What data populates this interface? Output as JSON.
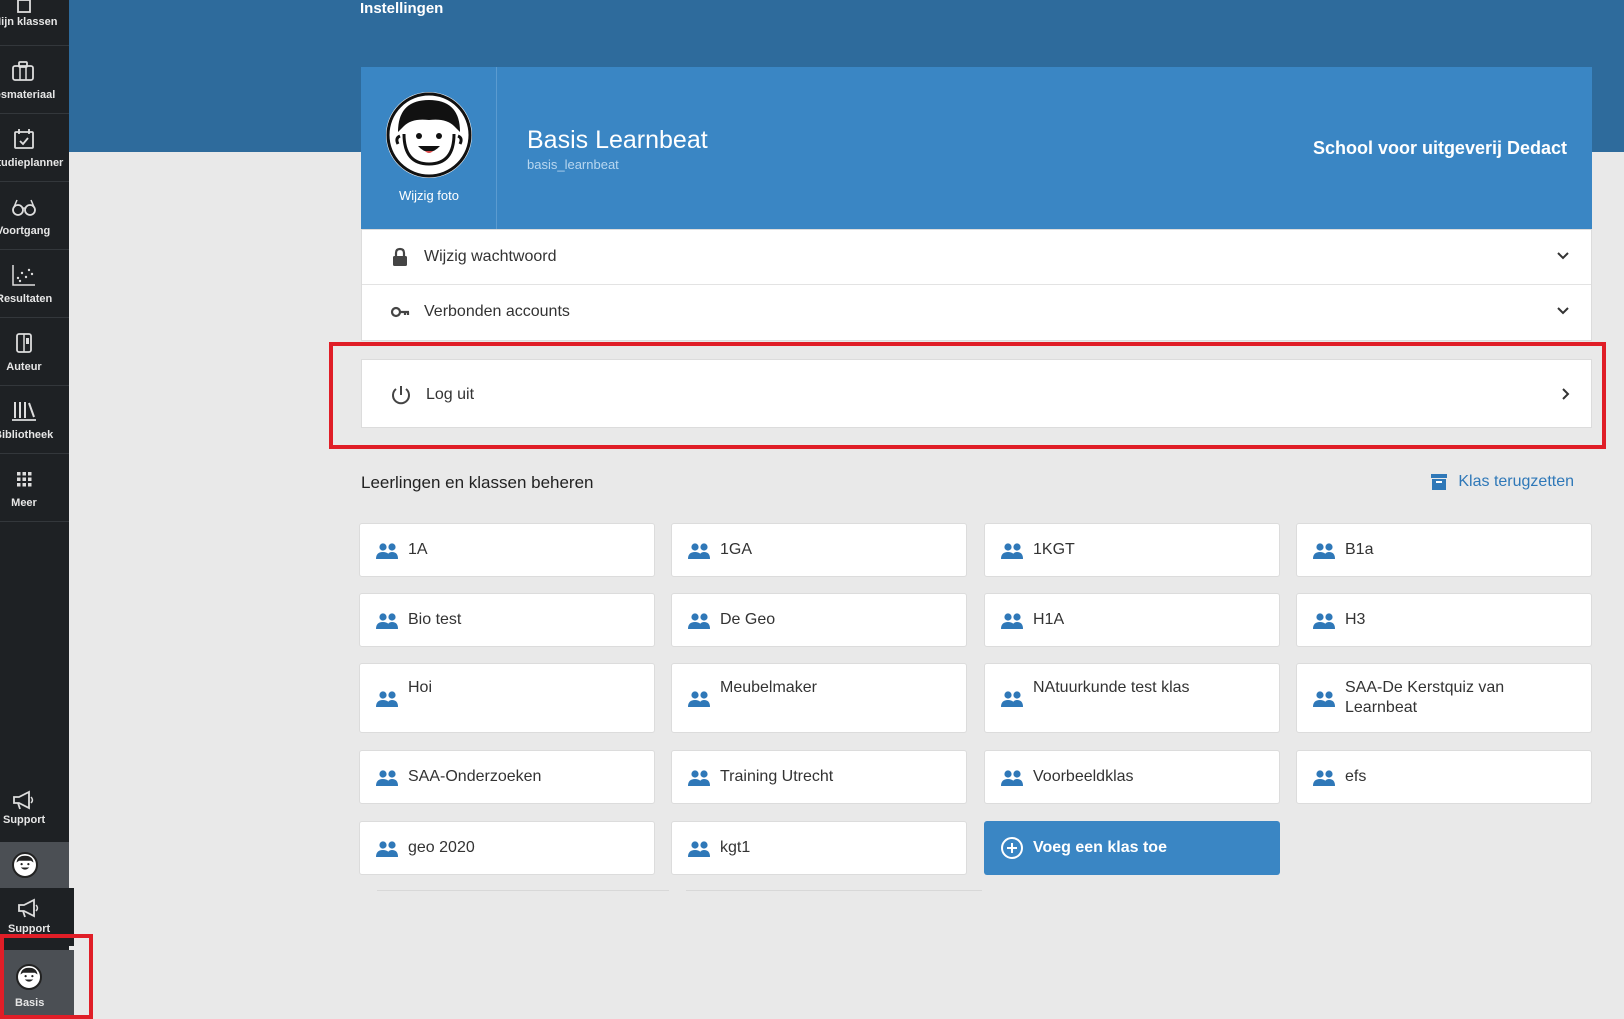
{
  "page": {
    "title": "Instellingen"
  },
  "sidebar": {
    "items": [
      {
        "label": "Mijn klassen",
        "icon": "class-icon"
      },
      {
        "label": "Lesmateriaal",
        "icon": "briefcase-icon"
      },
      {
        "label": "Studieplanner",
        "icon": "calendar-icon"
      },
      {
        "label": "Voortgang",
        "icon": "glasses-icon"
      },
      {
        "label": "Resultaten",
        "icon": "scatter-chart-icon"
      },
      {
        "label": "Auteur",
        "icon": "author-icon"
      },
      {
        "label": "Bibliotheek",
        "icon": "library-icon"
      },
      {
        "label": "Meer",
        "icon": "grid-icon"
      }
    ],
    "support_label": "Support",
    "support_label_2": "Support",
    "user_label": "Basis"
  },
  "profile": {
    "change_photo": "Wijzig foto",
    "name": "Basis Learnbeat",
    "username": "basis_learnbeat",
    "school": "School voor uitgeverij Dedact"
  },
  "settings": {
    "change_password": "Wijzig wachtwoord",
    "connected_accounts": "Verbonden accounts",
    "logout": "Log uit"
  },
  "classes_section": {
    "title": "Leerlingen en klassen beheren",
    "restore": "Klas terugzetten",
    "classes": [
      "1A",
      "1GA",
      "1KGT",
      "B1a",
      "Bio test",
      "De Geo",
      "H1A",
      "H3",
      "Hoi",
      "Meubelmaker",
      "NAtuurkunde test klas",
      "SAA-De Kerstquiz van Learnbeat",
      "SAA-Onderzoeken",
      "Training Utrecht",
      "Voorbeeldklas",
      "efs",
      "geo 2020",
      "kgt1"
    ],
    "add_class": "Voeg een klas toe"
  },
  "colors": {
    "sidebar_bg": "#1e2124",
    "banner_bg": "#2e6b9c",
    "card_blue": "#3a86c4",
    "highlight_red": "#e01e27",
    "link_blue": "#2f78b8"
  }
}
